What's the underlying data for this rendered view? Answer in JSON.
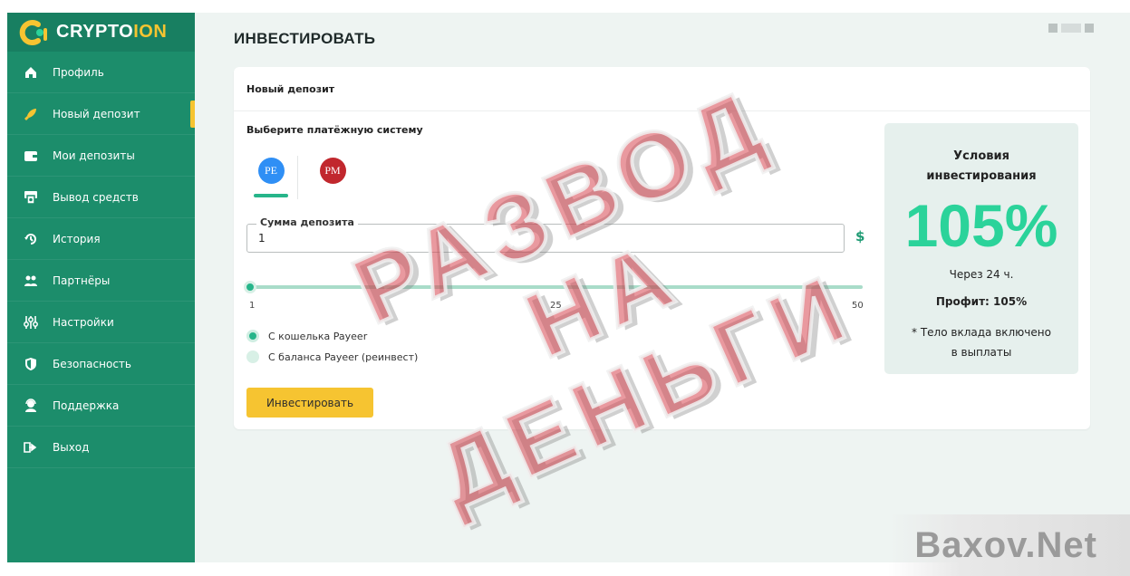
{
  "brand": {
    "name_main": "CRYPTO",
    "name_accent": "ION",
    "colors": {
      "primary": "#1c8d6b",
      "accent": "#f6c431",
      "highlight": "#2bd39a"
    }
  },
  "sidebar": {
    "items": [
      {
        "label": "Профиль",
        "icon": "home-icon"
      },
      {
        "label": "Новый депозит",
        "icon": "rocket-icon",
        "active": true
      },
      {
        "label": "Мои депозиты",
        "icon": "wallet-icon"
      },
      {
        "label": "Вывод средств",
        "icon": "atm-icon"
      },
      {
        "label": "История",
        "icon": "history-icon"
      },
      {
        "label": "Партнёры",
        "icon": "partners-icon"
      },
      {
        "label": "Настройки",
        "icon": "settings-sliders-icon"
      },
      {
        "label": "Безопасность",
        "icon": "shield-icon"
      },
      {
        "label": "Поддержка",
        "icon": "support-icon"
      },
      {
        "label": "Выход",
        "icon": "logout-icon"
      }
    ]
  },
  "header": {
    "title": "ИНВЕСТИРОВАТЬ"
  },
  "card": {
    "title": "Новый депозит",
    "payment_label": "Выберите платёжную систему",
    "payment_systems": [
      {
        "short": "PE",
        "icon": "payeer-logo",
        "selected": true
      },
      {
        "short": "PM",
        "icon": "perfect-money-logo",
        "selected": false
      }
    ],
    "amount": {
      "legend": "Сумма депозита",
      "value": "1",
      "currency": "$"
    },
    "slider": {
      "min": "1",
      "mid": "25",
      "max": "50",
      "value": 1
    },
    "source_options": [
      {
        "label": "С кошелька Payeer",
        "selected": true
      },
      {
        "label": "С баланса Payeer (реинвест)",
        "selected": false
      }
    ],
    "submit_label": "Инвестировать"
  },
  "conditions": {
    "title": "Условия инвестирования",
    "percent": "105%",
    "term": "Через 24 ч.",
    "profit": "Профит: 105%",
    "note": "* Тело вклада включено в выплаты"
  },
  "overlay": {
    "line1": "РАЗВОД",
    "line2": "НА ДЕНЬГИ"
  },
  "watermark": "Baxov.Net"
}
